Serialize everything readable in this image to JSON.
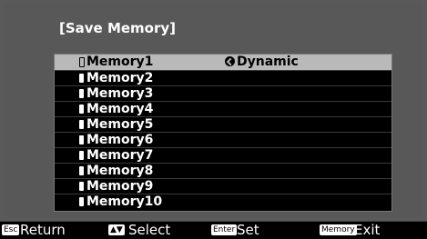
{
  "title": "[Save Memory]",
  "memories": [
    {
      "label": "Memory1",
      "mode": "Dynamic",
      "selected": true
    },
    {
      "label": "Memory2"
    },
    {
      "label": "Memory3"
    },
    {
      "label": "Memory4"
    },
    {
      "label": "Memory5"
    },
    {
      "label": "Memory6"
    },
    {
      "label": "Memory7"
    },
    {
      "label": "Memory8"
    },
    {
      "label": "Memory9"
    },
    {
      "label": "Memory10"
    }
  ],
  "footer": {
    "return": {
      "key": "Esc",
      "label": "Return"
    },
    "select": {
      "key": "▲▼",
      "label": "Select"
    },
    "set": {
      "key": "Enter",
      "label": "Set"
    },
    "exit": {
      "key": "Memory",
      "label": "Exit"
    }
  }
}
